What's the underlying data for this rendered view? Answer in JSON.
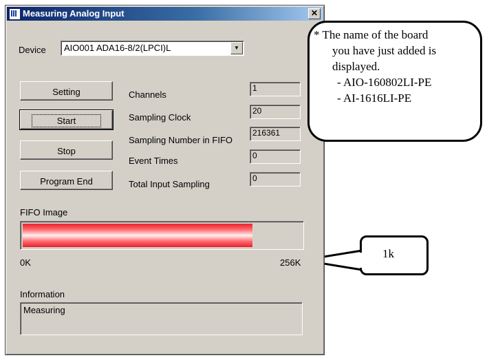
{
  "window": {
    "title": "Measuring Analog Input",
    "close_glyph": "✕"
  },
  "device": {
    "label": "Device",
    "value": "AIO001 ADA16-8/2(LPCI)L"
  },
  "buttons": {
    "setting": "Setting",
    "start": "Start",
    "stop": "Stop",
    "program_end": "Program End"
  },
  "stats": [
    {
      "label": "Channels",
      "value": "1"
    },
    {
      "label": "Sampling Clock",
      "value": "20"
    },
    {
      "label": "Sampling Number in FIFO",
      "value": "216361"
    },
    {
      "label": "Event Times",
      "value": "0"
    },
    {
      "label": "Total Input Sampling",
      "value": "0"
    }
  ],
  "fifo": {
    "label": "FIFO Image",
    "min_label": "0K",
    "max_label": "256K",
    "fill_fraction": 0.825,
    "fill_color": "#e8202a"
  },
  "information": {
    "label": "Information",
    "text": "Measuring"
  },
  "callouts": {
    "board": {
      "lines": [
        "* The name of the board",
        "you have just added is",
        "displayed.",
        "- AIO-160802LI-PE",
        "- AI-1616LI-PE"
      ]
    },
    "unit": {
      "text": "1k"
    }
  }
}
